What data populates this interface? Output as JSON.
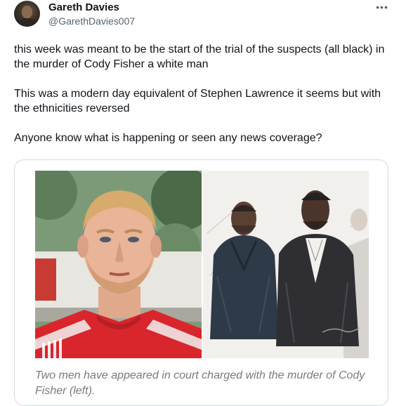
{
  "author": {
    "name": "Gareth Davies",
    "handle": "@GarethDavies007"
  },
  "more_icon": "more-horizontal-icon",
  "more_glyph": "•••",
  "tweet": {
    "paragraphs": [
      "this week was meant to be the start of the trial of the suspects (all black) in the murder of Cody Fisher a white man",
      "This was a modern day equivalent of Stephen Lawrence it seems but with the ethnicities reversed",
      "Anyone know what is happening or seen any news coverage?"
    ]
  },
  "media": {
    "caption": "Two men have appeared in court charged with the murder of Cody Fisher (left).",
    "left_image": "portrait-photo",
    "right_image": "court-sketch"
  },
  "colors": {
    "text": "#0f1419",
    "secondary": "#536471",
    "border": "#cfd9de",
    "caption": "#7a7a7a",
    "jersey_red": "#d8262c"
  }
}
